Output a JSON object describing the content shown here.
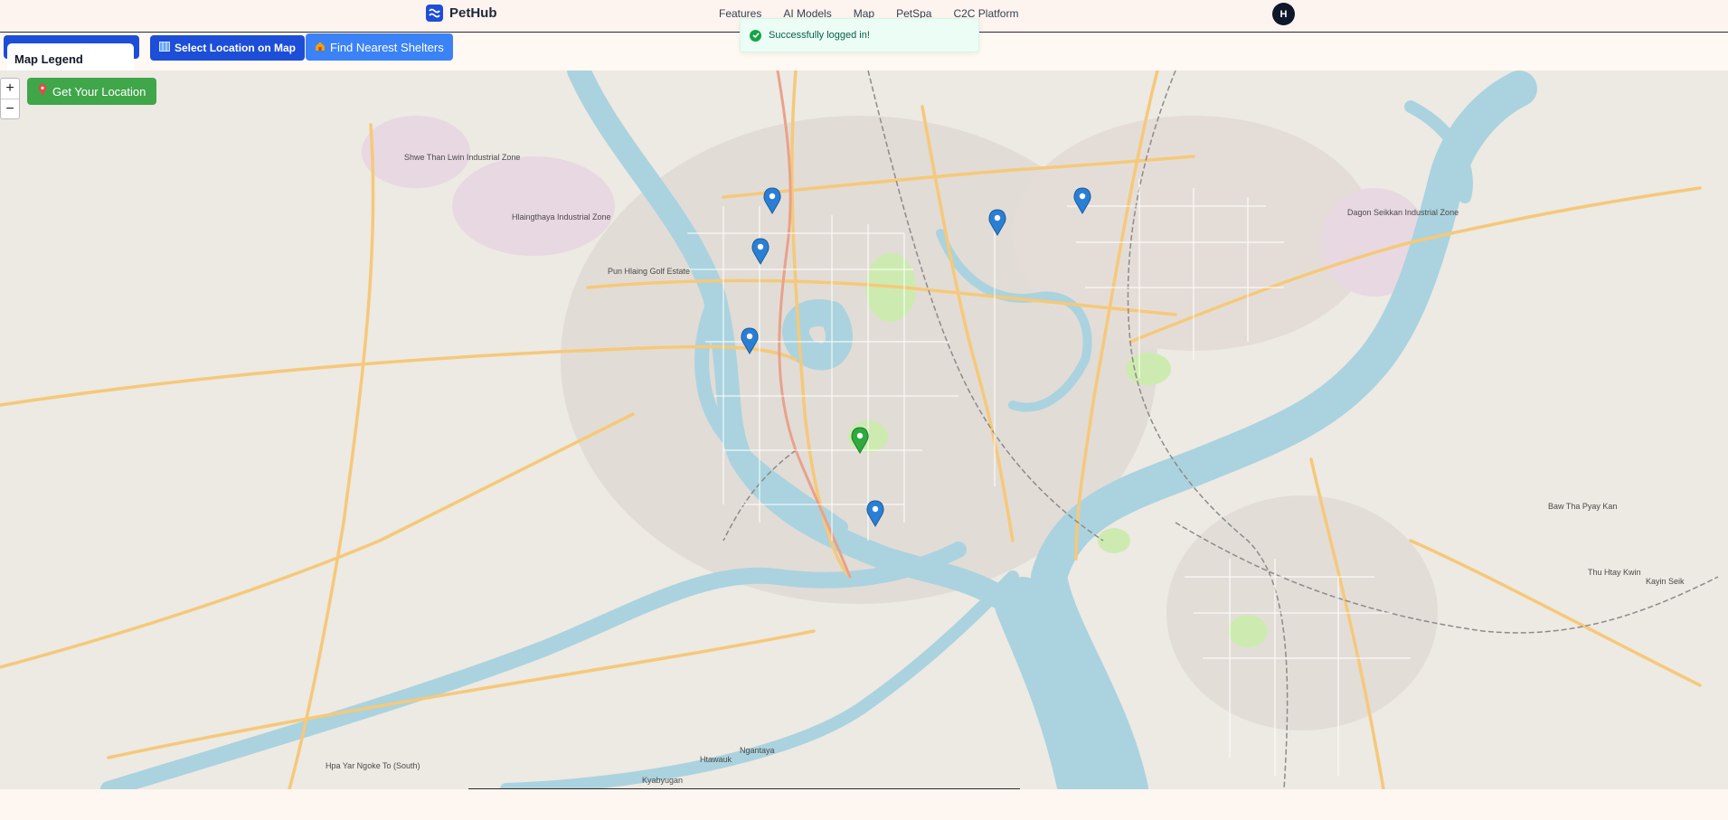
{
  "brand": {
    "name": "PetHub"
  },
  "nav": {
    "items": [
      "Features",
      "AI Models",
      "Map",
      "PetSpa",
      "C2C Platform"
    ]
  },
  "user": {
    "avatar_initial": "H"
  },
  "toast": {
    "message": "Successfully logged in!"
  },
  "toolbar": {
    "hidden_button_label": "",
    "select_label": "Select Location on Map",
    "find_label": "Find Nearest Shelters"
  },
  "legend": {
    "title": "Map Legend"
  },
  "map": {
    "zoom_in": "+",
    "zoom_out": "−",
    "get_location_label": "Get Your Location",
    "labels": {
      "shwe_than": "Shwe Than Lwin Industrial Zone",
      "hlaing": "Hlaingthaya Industrial Zone",
      "pun_hlaing": "Pun Hlaing Golf Estate",
      "dagon": "Dagon Seikkan Industrial Zone",
      "baw_tha": "Baw Tha Pyay Kan",
      "thu_htay": "Thu Htay Kwin",
      "hpa_yar": "Hpa Yar Ngoke To (South)",
      "ngantaya": "Ngantaya",
      "htawauk": "Htawauk",
      "kyabyugan": "Kyabyugan",
      "kayin": "Kayin Seik"
    }
  },
  "colors": {
    "primary": "#1d4ed8",
    "find": "#3b82f6",
    "get_location": "#3fa64a",
    "river": "#aad3df",
    "marker": "#2a7fd4",
    "user_marker": "#2eaa3e"
  }
}
